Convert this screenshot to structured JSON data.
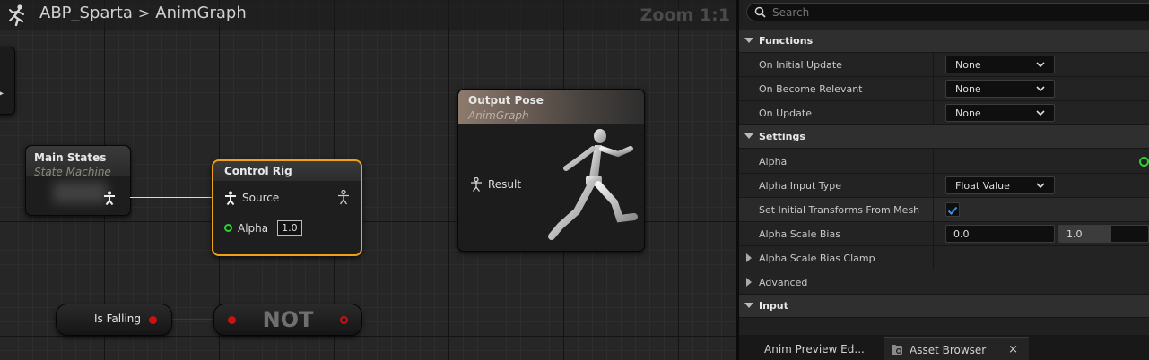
{
  "graph": {
    "breadcrumb": {
      "asset": "ABP_Sparta",
      "separator": ">",
      "graph": "AnimGraph"
    },
    "zoom": "Zoom 1:1",
    "nodes": {
      "main_states": {
        "title": "Main States",
        "subtitle": "State Machine"
      },
      "control_rig": {
        "title": "Control Rig",
        "source_label": "Source",
        "alpha_label": "Alpha",
        "alpha_value": "1.0"
      },
      "output_pose": {
        "title": "Output Pose",
        "subtitle": "AnimGraph",
        "result_label": "Result"
      },
      "is_falling": {
        "label": "Is Falling"
      },
      "not": {
        "label": "NOT"
      }
    },
    "colors": {
      "selection": "#f0a116",
      "bool_wire": "#cc1111",
      "float_pin": "#2fd12f"
    }
  },
  "details": {
    "search": {
      "placeholder": "Search",
      "value": ""
    },
    "sections": {
      "functions": "Functions",
      "settings": "Settings",
      "input": "Input"
    },
    "properties": {
      "on_initial_update": {
        "name": "On Initial Update",
        "value": "None"
      },
      "on_become_relevant": {
        "name": "On Become Relevant",
        "value": "None"
      },
      "on_update": {
        "name": "On Update",
        "value": "None"
      },
      "alpha": {
        "name": "Alpha"
      },
      "alpha_input_type": {
        "name": "Alpha Input Type",
        "value": "Float Value"
      },
      "set_initial_transforms": {
        "name": "Set Initial Transforms From Mesh",
        "checked": true
      },
      "alpha_scale_bias": {
        "name": "Alpha Scale Bias",
        "min": "0.0",
        "max": "1.0"
      },
      "alpha_scale_bias_clamp": {
        "name": "Alpha Scale Bias Clamp"
      },
      "advanced": {
        "name": "Advanced"
      }
    },
    "tabs": {
      "anim_preview": "Anim Preview Ed...",
      "asset_browser": "Asset Browser",
      "close_glyph": "×"
    }
  }
}
